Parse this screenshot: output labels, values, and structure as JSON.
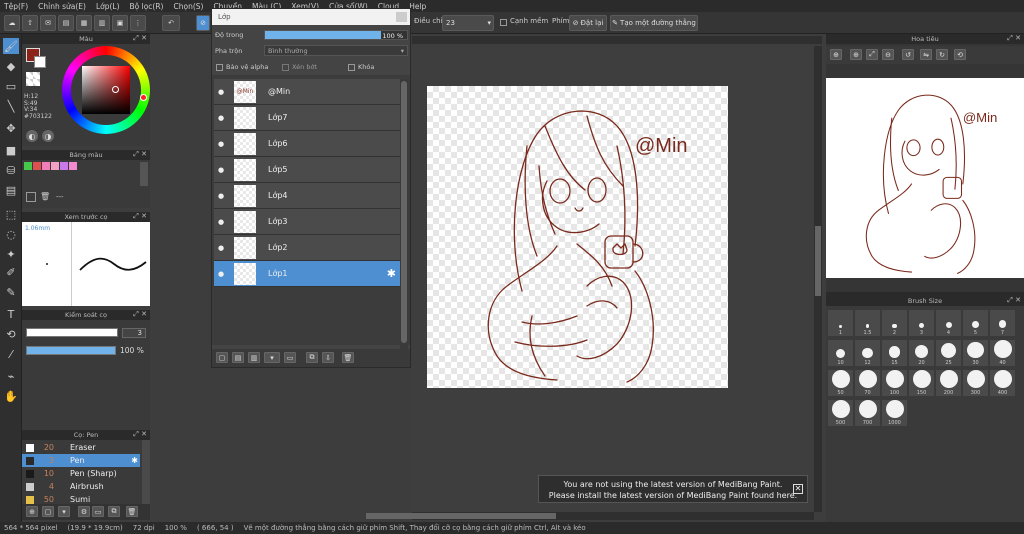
{
  "menu": [
    "Tệp(F)",
    "Chỉnh sửa(E)",
    "Lớp(L)",
    "Bộ lọc(R)",
    "Chọn(S)",
    "Chuyển",
    "Màu (C)",
    "Xem(V)",
    "Cửa sổ(W)",
    "Cloud",
    "Help"
  ],
  "toolbar": {
    "adjust_label": "Điều chỉnh",
    "adjust_value": "23",
    "smooth_label": "Cạnh mềm",
    "brush_label": "Phím",
    "reset_label": "Đặt lại",
    "straight_line_label": "Tạo một đường thẳng"
  },
  "color_panel": {
    "title": "Màu",
    "h": "H:12",
    "s": "S:49",
    "v": "V:34",
    "hex": "#703122",
    "main_color": "#8b2318"
  },
  "palette_panel": {
    "title": "Bảng màu",
    "swatches": [
      "#46c84a",
      "#e05050",
      "#ef7fb6",
      "#f2a0c4",
      "#c87ae8",
      "#f28ad0"
    ],
    "page": "---"
  },
  "brush_preview": {
    "title": "Xem trước cọ",
    "size": "1.06mm"
  },
  "control_panel": {
    "title": "Kiểm soát cọ",
    "size_value": "3",
    "opacity_value": "100 %",
    "size_fill": 0.95,
    "opacity_fill": 1.0
  },
  "brush_panel": {
    "title": "Cọ: Pen",
    "brushes": [
      {
        "size": "20",
        "name": "Eraser",
        "swatch": "#ffffff",
        "selected": false
      },
      {
        "size": "3",
        "name": "Pen",
        "swatch": "#2b2b2b",
        "selected": true
      },
      {
        "size": "10",
        "name": "Pen (Sharp)",
        "swatch": "#1a1a1a",
        "selected": false
      },
      {
        "size": "4",
        "name": "Airbrush",
        "swatch": "#cccccc",
        "selected": false
      },
      {
        "size": "50",
        "name": "Sumi",
        "swatch": "#e6c14a",
        "selected": false
      }
    ]
  },
  "layer_panel": {
    "title": "Lớp",
    "opacity_label": "Độ trong",
    "opacity_value": "100 %",
    "blend_label": "Pha trộn",
    "blend_value": "Bình thường",
    "protect_alpha": "Bảo vệ alpha",
    "clipping": "Xén bớt",
    "lock": "Khóa",
    "layers": [
      {
        "name": "@Min",
        "thumb": "@Min",
        "selected": false
      },
      {
        "name": "Lớp7",
        "thumb": "",
        "selected": false
      },
      {
        "name": "Lớp6",
        "thumb": "",
        "selected": false
      },
      {
        "name": "Lớp5",
        "thumb": "",
        "selected": false
      },
      {
        "name": "Lớp4",
        "thumb": "",
        "selected": false
      },
      {
        "name": "Lớp3",
        "thumb": "",
        "selected": false
      },
      {
        "name": "Lớp2",
        "thumb": "",
        "selected": false
      },
      {
        "name": "Lớp1",
        "thumb": "",
        "selected": true
      }
    ]
  },
  "canvas": {
    "signature": "@Min",
    "line_color": "#7a2a1c"
  },
  "navigator": {
    "title": "Hoa tiêu",
    "signature": "@Min"
  },
  "brush_size_panel": {
    "title": "Brush Size",
    "sizes": [
      "1",
      "1.5",
      "2",
      "3",
      "4",
      "5",
      "7",
      "10",
      "12",
      "15",
      "20",
      "25",
      "30",
      "40",
      "50",
      "70",
      "100",
      "150",
      "200",
      "300",
      "400",
      "500",
      "700",
      "1000"
    ]
  },
  "notice": {
    "line1": "You are not using the latest version of MediBang Paint.",
    "line2": "Please install the latest version of MediBang Paint found here."
  },
  "status": {
    "dims": "564 * 564 pixel",
    "cm": "(19.9 * 19.9cm)",
    "dpi": "72 dpi",
    "zoom": "100 %",
    "coords": "( 666, 54 )",
    "hint": "Vẽ một đường thẳng bằng cách giữ phím Shift, Thay đổi cỡ cọ bằng cách giữ phím Ctrl, Alt và kéo"
  }
}
